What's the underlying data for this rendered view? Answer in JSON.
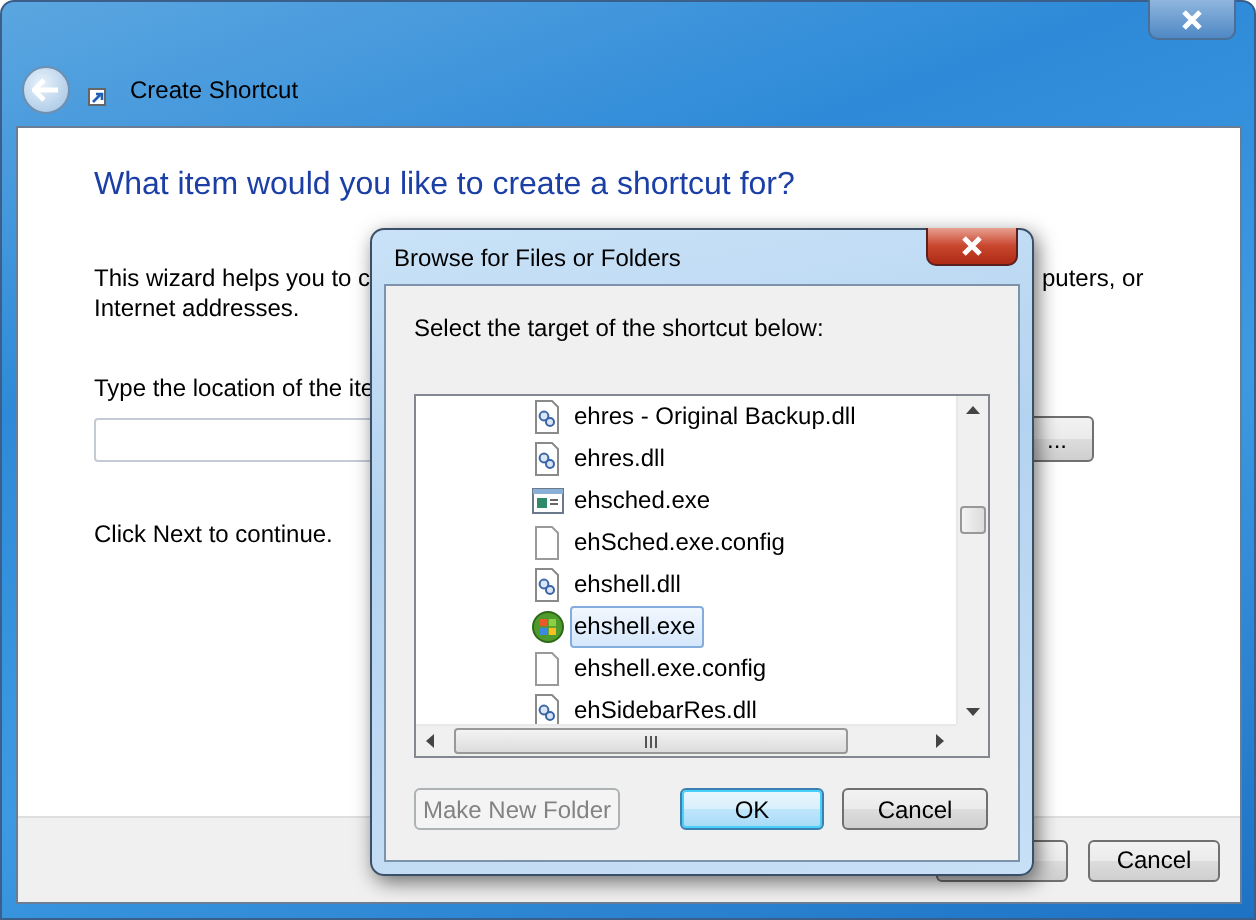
{
  "window": {
    "title": "Create Shortcut"
  },
  "wizard": {
    "heading": "What item would you like to create a shortcut for?",
    "intro_left": "This wizard helps you to c",
    "intro_right": "puters, or",
    "intro_line2": "Internet addresses.",
    "location_label": "Type the location of the ite",
    "browse_button": "...",
    "hint": "Click Next to continue.",
    "cancel_button": "Cancel"
  },
  "dialog": {
    "title": "Browse for Files or Folders",
    "prompt": "Select the target of the shortcut below:",
    "items": [
      {
        "name": "ehres - Original Backup.dll",
        "kind": "library",
        "selected": false
      },
      {
        "name": "ehres.dll",
        "kind": "library",
        "selected": false
      },
      {
        "name": "ehsched.exe",
        "kind": "program",
        "selected": false
      },
      {
        "name": "ehSched.exe.config",
        "kind": "file",
        "selected": false
      },
      {
        "name": "ehshell.dll",
        "kind": "library",
        "selected": false
      },
      {
        "name": "ehshell.exe",
        "kind": "app",
        "selected": true
      },
      {
        "name": "ehshell.exe.config",
        "kind": "file",
        "selected": false
      },
      {
        "name": "ehSidebarRes.dll",
        "kind": "library",
        "selected": false
      }
    ],
    "buttons": [
      {
        "label": "Make New Folder",
        "disabled": true,
        "default": false
      },
      {
        "label": "OK",
        "disabled": false,
        "default": true
      },
      {
        "label": "Cancel",
        "disabled": false,
        "default": false
      }
    ]
  }
}
